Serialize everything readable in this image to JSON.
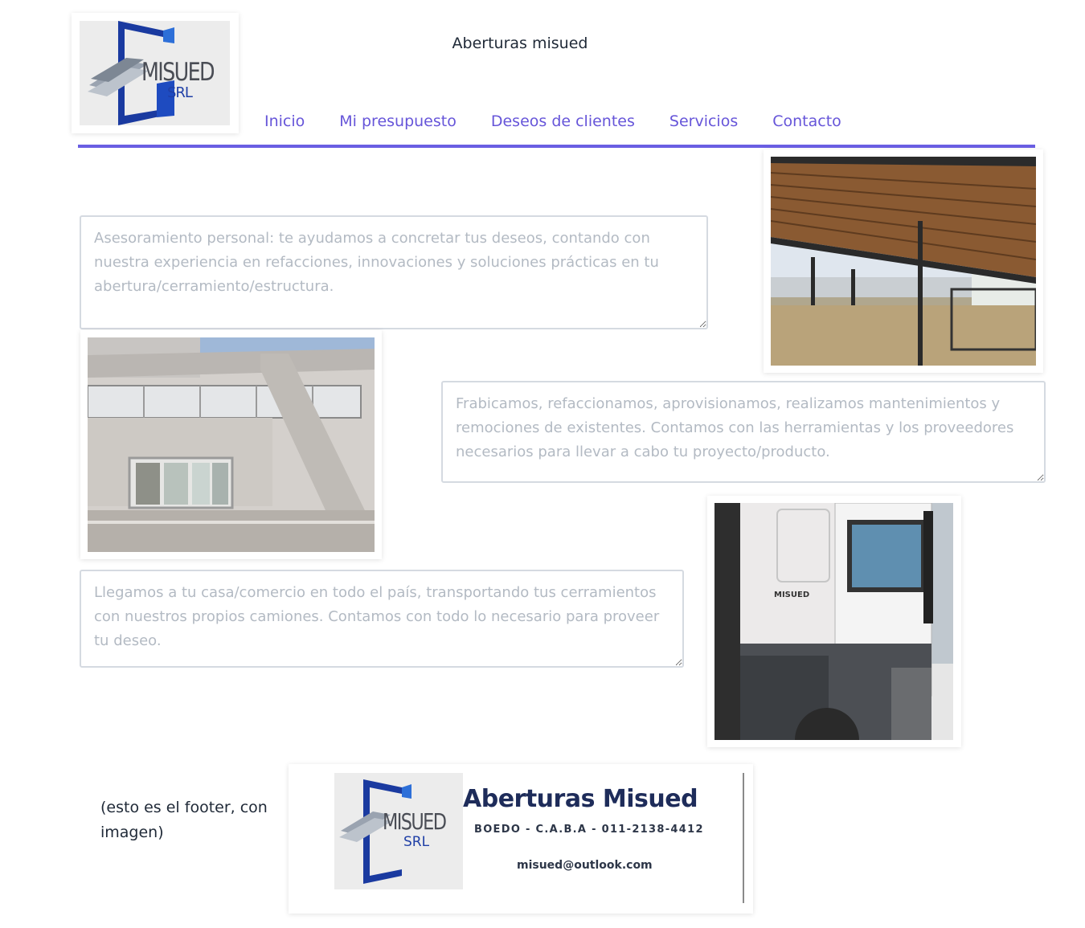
{
  "header": {
    "title": "Aberturas misued",
    "logo": {
      "brand": "MISUED",
      "suffix": "SRL"
    }
  },
  "nav": {
    "items": [
      {
        "label": "Inicio"
      },
      {
        "label": "Mi presupuesto"
      },
      {
        "label": "Deseos de clientes"
      },
      {
        "label": "Servicios"
      },
      {
        "label": "Contacto"
      }
    ]
  },
  "services": {
    "advice_text": "Asesoramiento personal: te ayudamos a concretar tus deseos, contando con nuestra experiencia en refacciones, innovaciones y soluciones prácticas en tu abertura/cerramiento/estructura.",
    "fabrication_text": "Frabicamos, refaccionamos, aprovisionamos, realizamos mantenimientos y remociones de existentes. Contamos con las herramientas y los proveedores necesarios para llevar a cabo tu proyecto/producto.",
    "transport_text": "Llegamos a tu casa/comercio en todo el país, transportando tus cerramientos con nuestros propios camiones. Contamos con todo lo necesario para proveer tu deseo."
  },
  "footer": {
    "note": "(esto es el footer, con imagen)",
    "company": "Aberturas Misued",
    "address": "BOEDO - C.A.B.A - 011-2138-4412",
    "email": "misued@outlook.com",
    "logo": {
      "brand": "MISUED",
      "suffix": "SRL"
    }
  },
  "colors": {
    "accent": "#6a5ee3",
    "nav_text": "#6655d9",
    "placeholder": "#b3bac3"
  }
}
